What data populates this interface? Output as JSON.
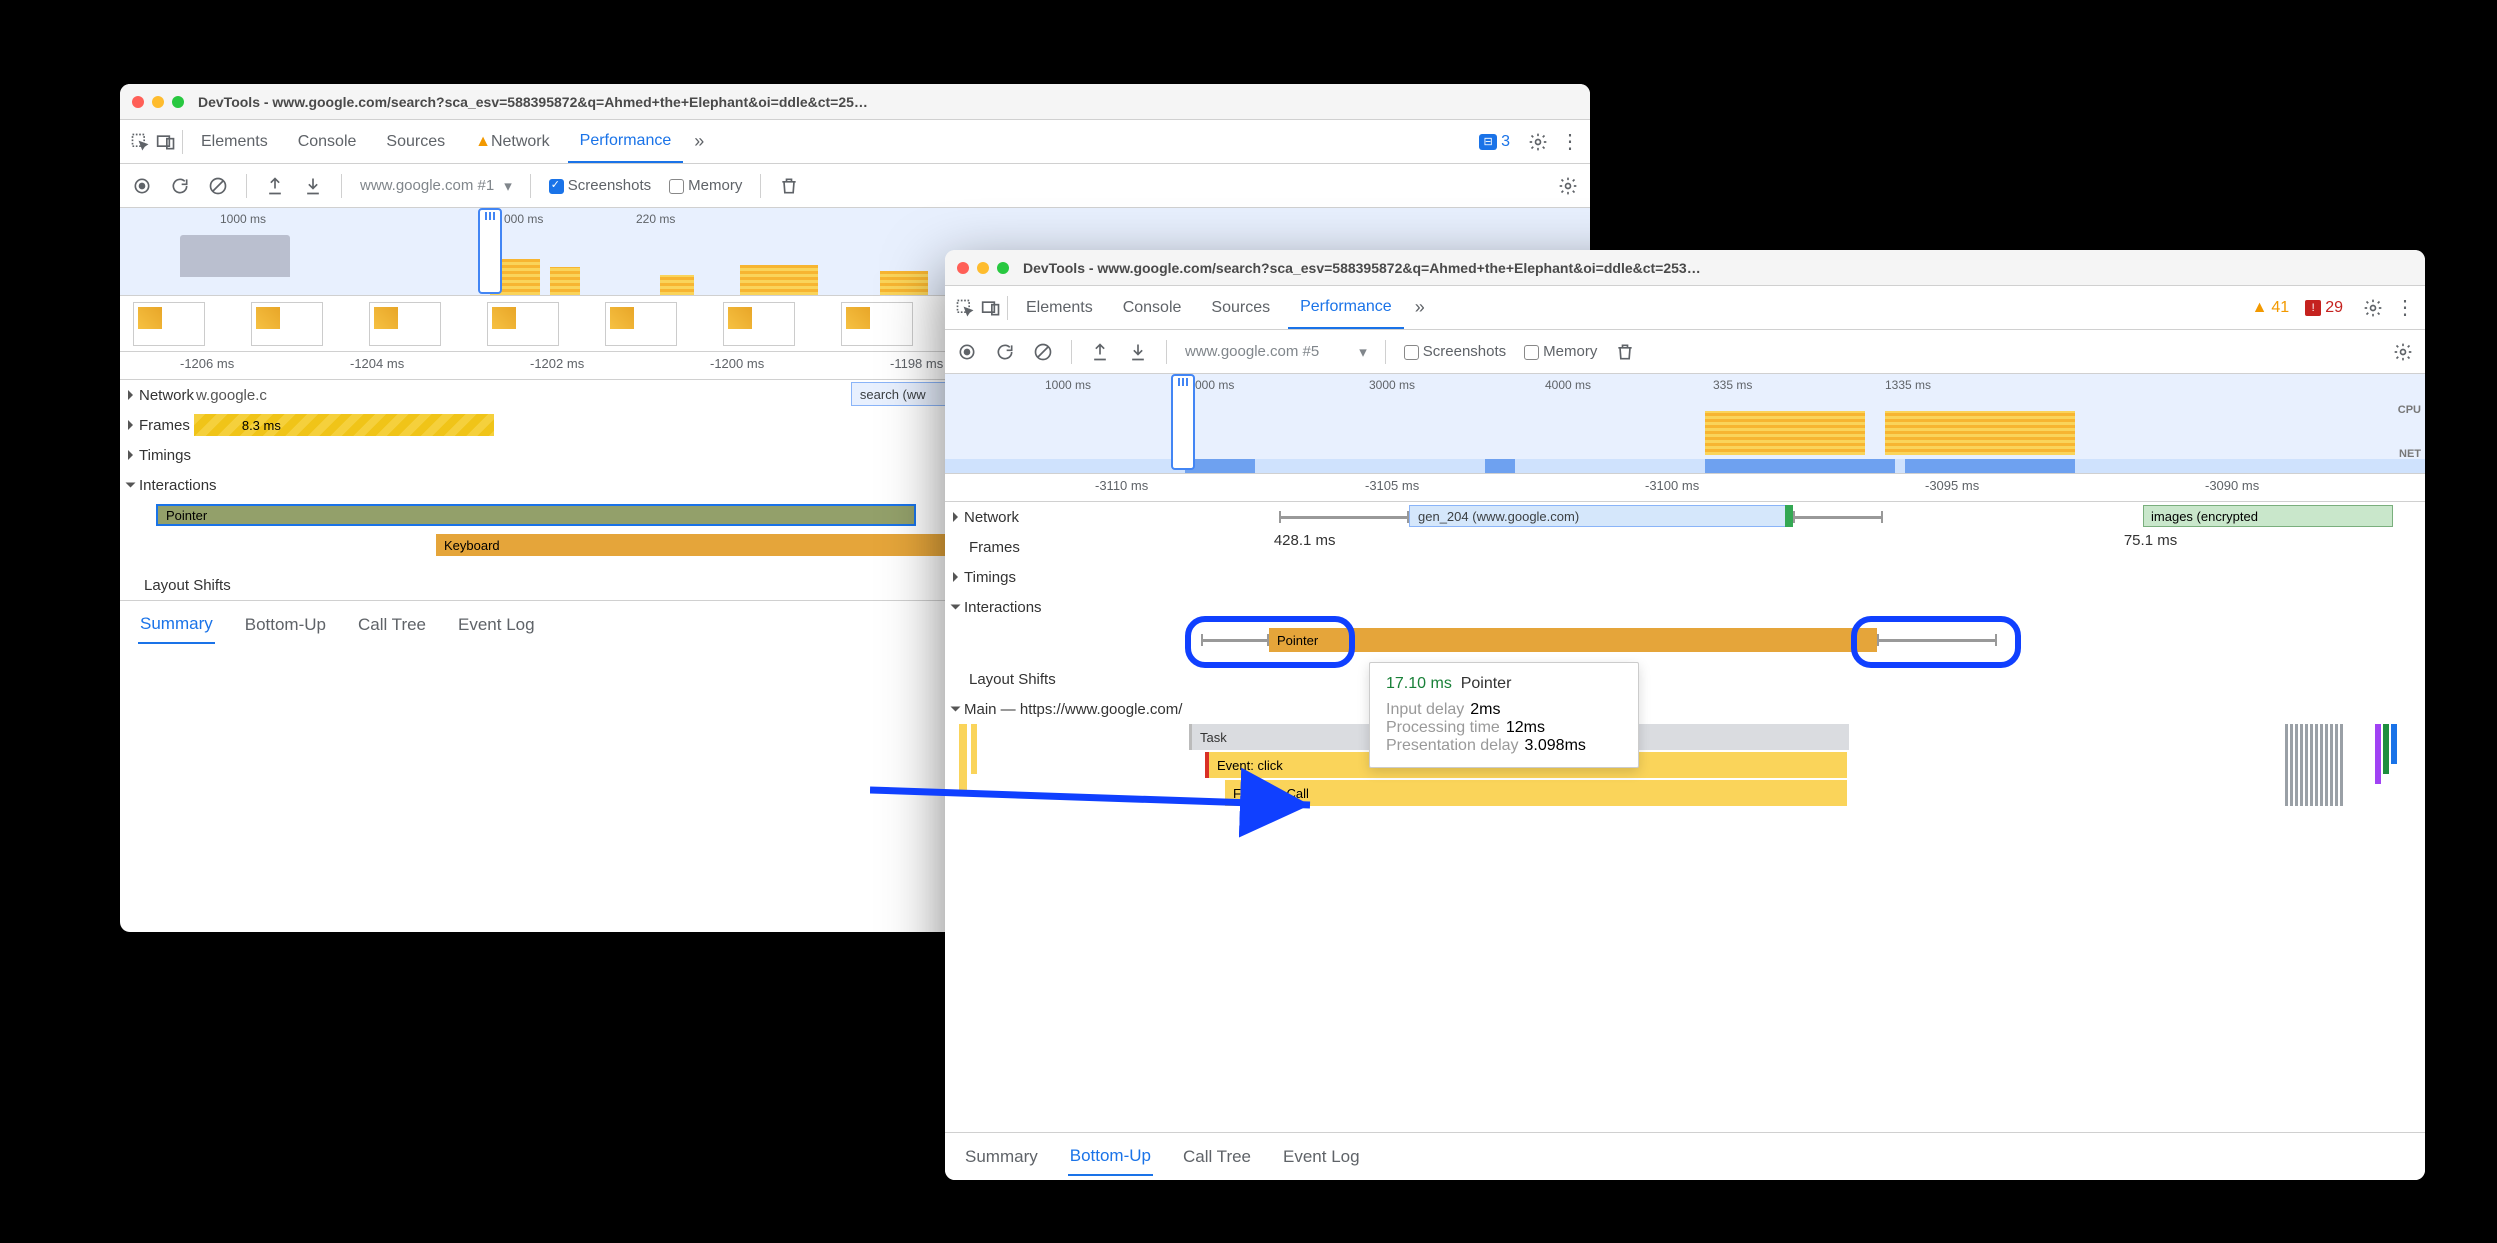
{
  "w1": {
    "title": "DevTools - www.google.com/search?sca_esv=588395872&q=Ahmed+the+Elephant&oi=ddle&ct=25…",
    "tabs": {
      "elements": "Elements",
      "console": "Console",
      "sources": "Sources",
      "network": "Network",
      "performance": "Performance"
    },
    "chat_count": "3",
    "toolbar": {
      "profile": "www.google.com #1",
      "screenshots": "Screenshots",
      "memory": "Memory"
    },
    "overview": {
      "t1": "1000 ms",
      "t2": "000 ms",
      "t3": "220 ms"
    },
    "ruler": {
      "t0": "-1206 ms",
      "t1": "-1204 ms",
      "t2": "-1202 ms",
      "t3": "-1200 ms",
      "t4": "-1198 ms"
    },
    "tracks": {
      "network": "Network",
      "network_val": "w.google.c",
      "search_req": "search (ww",
      "frames": "Frames",
      "frames_val": "8.3 ms",
      "timings": "Timings",
      "interactions": "Interactions",
      "pointer": "Pointer",
      "keyboard": "Keyboard",
      "layout_shifts": "Layout Shifts"
    },
    "bottom": {
      "summary": "Summary",
      "bottomup": "Bottom-Up",
      "calltree": "Call Tree",
      "eventlog": "Event Log",
      "active": "summary"
    }
  },
  "w2": {
    "title": "DevTools - www.google.com/search?sca_esv=588395872&q=Ahmed+the+Elephant&oi=ddle&ct=253…",
    "tabs": {
      "elements": "Elements",
      "console": "Console",
      "sources": "Sources",
      "performance": "Performance"
    },
    "warn_count": "41",
    "err_count": "29",
    "toolbar": {
      "profile": "www.google.com #5",
      "screenshots": "Screenshots",
      "memory": "Memory"
    },
    "overview": {
      "t1": "1000 ms",
      "t2": "000 ms",
      "t3": "3000 ms",
      "t4": "4000 ms",
      "t5": "335 ms",
      "t6": "1335 ms",
      "cpu": "CPU",
      "net": "NET"
    },
    "ruler": {
      "t0": "-3110 ms",
      "t1": "-3105 ms",
      "t2": "-3100 ms",
      "t3": "-3095 ms",
      "t4": "-3090 ms"
    },
    "tracks": {
      "network": "Network",
      "gen204": "gen_204 (www.google.com)",
      "images": "images (encrypted",
      "frames": "Frames",
      "frames_val1": "428.1 ms",
      "frames_val2": "75.1 ms",
      "timings": "Timings",
      "interactions": "Interactions",
      "pointer": "Pointer",
      "layout_shifts": "Layout Shifts",
      "main": "Main — https://www.google.com/",
      "task": "Task",
      "event_click": "Event: click",
      "func": "Function Call"
    },
    "tooltip": {
      "ms": "17.10 ms",
      "name": "Pointer",
      "r1": "Input delay",
      "v1": "2ms",
      "r2": "Processing time",
      "v2": "12ms",
      "r3": "Presentation delay",
      "v3": "3.098ms"
    },
    "bottom": {
      "summary": "Summary",
      "bottomup": "Bottom-Up",
      "calltree": "Call Tree",
      "eventlog": "Event Log",
      "active": "bottomup"
    }
  }
}
